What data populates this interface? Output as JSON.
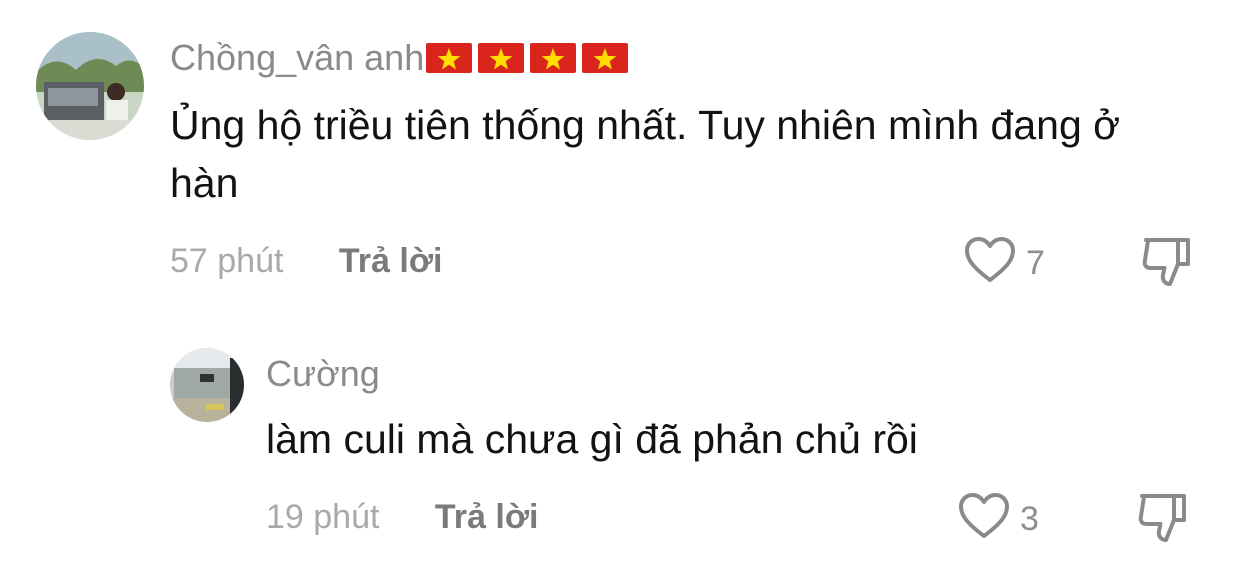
{
  "comments": [
    {
      "username": "Chồng_vân anh",
      "flag_count": 4,
      "text": "Ủng hộ triều tiên thống nhất. Tuy nhiên mình đang ở hàn",
      "time": "57 phút",
      "reply_label": "Trả lời",
      "likes": "7"
    },
    {
      "username": "Cường",
      "text": "làm culi mà chưa gì đã phản chủ rồi",
      "time": "19 phút",
      "reply_label": "Trả lời",
      "likes": "3"
    }
  ],
  "icons": {
    "flag": "vietnam-flag-icon",
    "like": "heart-outline-icon",
    "dislike": "thumbs-down-icon"
  },
  "colors": {
    "flag_red": "#da251d",
    "flag_star": "#ffde00",
    "muted_text": "#8a8a8a"
  }
}
